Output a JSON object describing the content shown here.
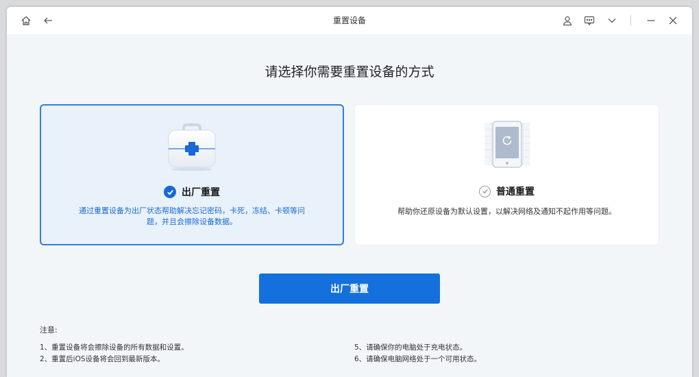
{
  "window": {
    "title": "重置设备"
  },
  "titlebar_icons": {
    "home": "home-icon",
    "back": "back-arrow-icon",
    "user": "user-icon",
    "feedback": "feedback-icon",
    "menu": "chevron-down-icon",
    "minimize": "minimize-icon",
    "close": "close-icon"
  },
  "main": {
    "heading": "请选择你需要重置设备的方式",
    "options": [
      {
        "title": "出厂重置",
        "description": "通过重置设备为出厂状态帮助解决忘记密码，卡死，冻结、卡顿等问题，并且会擦除设备数据。",
        "selected": true,
        "icon": "first-aid-kit-icon"
      },
      {
        "title": "普通重置",
        "description": "帮助你还原设备为默认设置，以解决网络及通知不起作用等问题。",
        "selected": false,
        "icon": "phone-reset-icon"
      }
    ],
    "primary_button": "出厂重置"
  },
  "notes": {
    "title": "注意:",
    "items": [
      "1、重置设备将会擦除设备的所有数据和设置。",
      "2、重置后iOS设备将会回到最新版本。",
      "5、请确保你的电脑处于充电状态。",
      "6、请确保电脑网络处于一个可用状态。"
    ]
  },
  "colors": {
    "accent": "#1470dc",
    "selected_border": "#2f7de1",
    "selected_bg": "#e9f1fb",
    "window_bg": "#f3f6f9"
  }
}
